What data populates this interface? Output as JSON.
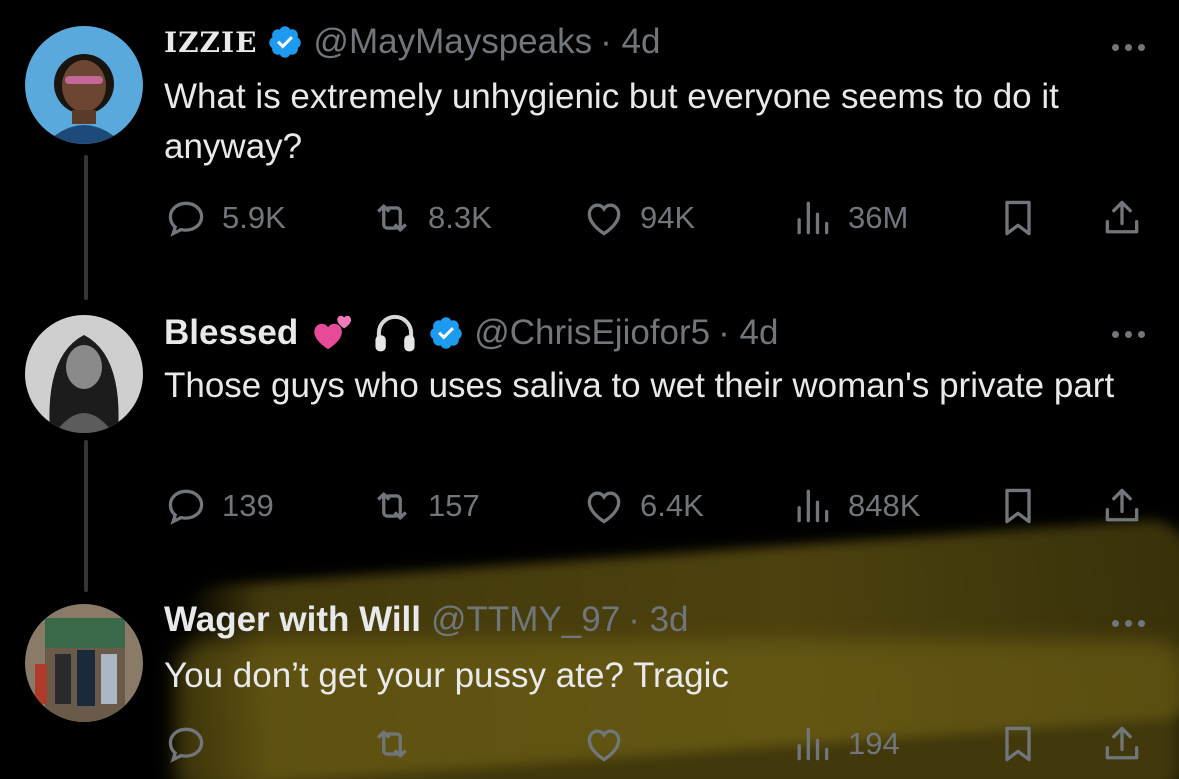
{
  "tweets": [
    {
      "name": "IZZIE",
      "handle": "@MayMayspeaks",
      "time": "· 4d",
      "verified": true,
      "text": "What is extremely unhygienic but everyone seems to do it anyway?",
      "metrics": {
        "replies": "5.9K",
        "reposts": "8.3K",
        "likes": "94K",
        "views": "36M"
      }
    },
    {
      "name": "Blessed",
      "handle": "@ChrisEjiofor5",
      "time": "· 4d",
      "verified": true,
      "emojis": [
        "heart-emoji",
        "headphones-emoji"
      ],
      "text": "Those guys who uses saliva to wet their woman's private part",
      "metrics": {
        "replies": "139",
        "reposts": "157",
        "likes": "6.4K",
        "views": "848K"
      }
    },
    {
      "name": "Wager with Will",
      "handle": "@TTMY_97",
      "time": "· 3d",
      "verified": false,
      "text": "You don’t get your pussy ate? Tragic",
      "metrics": {
        "replies": "",
        "reposts": "",
        "likes": "",
        "views": "194"
      }
    }
  ],
  "colors": {
    "background": "#000000",
    "text": "#e7e9ea",
    "muted": "#71767b",
    "verified": "#1d9bf0",
    "highlight": "#7a6a16"
  },
  "icons": [
    "reply-icon",
    "repost-icon",
    "like-icon",
    "views-icon",
    "bookmark-icon",
    "share-icon",
    "more-icon",
    "verified-badge-icon"
  ]
}
